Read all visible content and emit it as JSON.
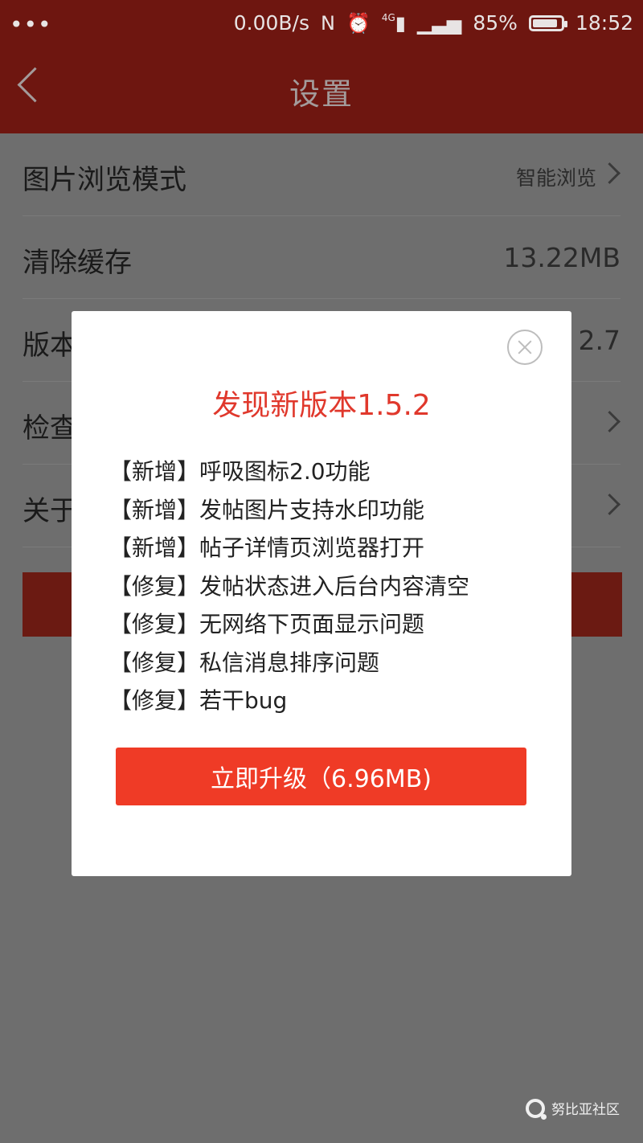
{
  "status_bar": {
    "dots": "•••",
    "network_speed": "0.00B/s",
    "nfc_icon": "N",
    "alarm_icon": "⏰",
    "signal_4g": "4G",
    "battery_percent": "85%",
    "time": "18:52"
  },
  "header": {
    "title": "设置"
  },
  "settings": {
    "items": [
      {
        "label": "图片浏览模式",
        "value": "智能浏览"
      },
      {
        "label": "清除缓存",
        "value": "13.22MB"
      },
      {
        "label": "版本",
        "value": "2.7"
      },
      {
        "label": "检查"
      },
      {
        "label": "关于"
      }
    ]
  },
  "dialog": {
    "title": "发现新版本1.5.2",
    "changelog": [
      "【新增】呼吸图标2.0功能",
      "【新增】发帖图片支持水印功能",
      "【新增】帖子详情页浏览器打开",
      "【修复】发帖状态进入后台内容清空",
      "【修复】无网络下页面显示问题",
      "【修复】私信消息排序问题",
      "【修复】若干bug"
    ],
    "upgrade_label": "立即升级（6.96MB)"
  },
  "watermark": {
    "text": "努比亚社区"
  },
  "colors": {
    "header_dim": "#6e1610",
    "overlay_gray": "#6e6e6e",
    "dialog_title": "#e0382c",
    "upgrade_button": "#ef3b26"
  }
}
